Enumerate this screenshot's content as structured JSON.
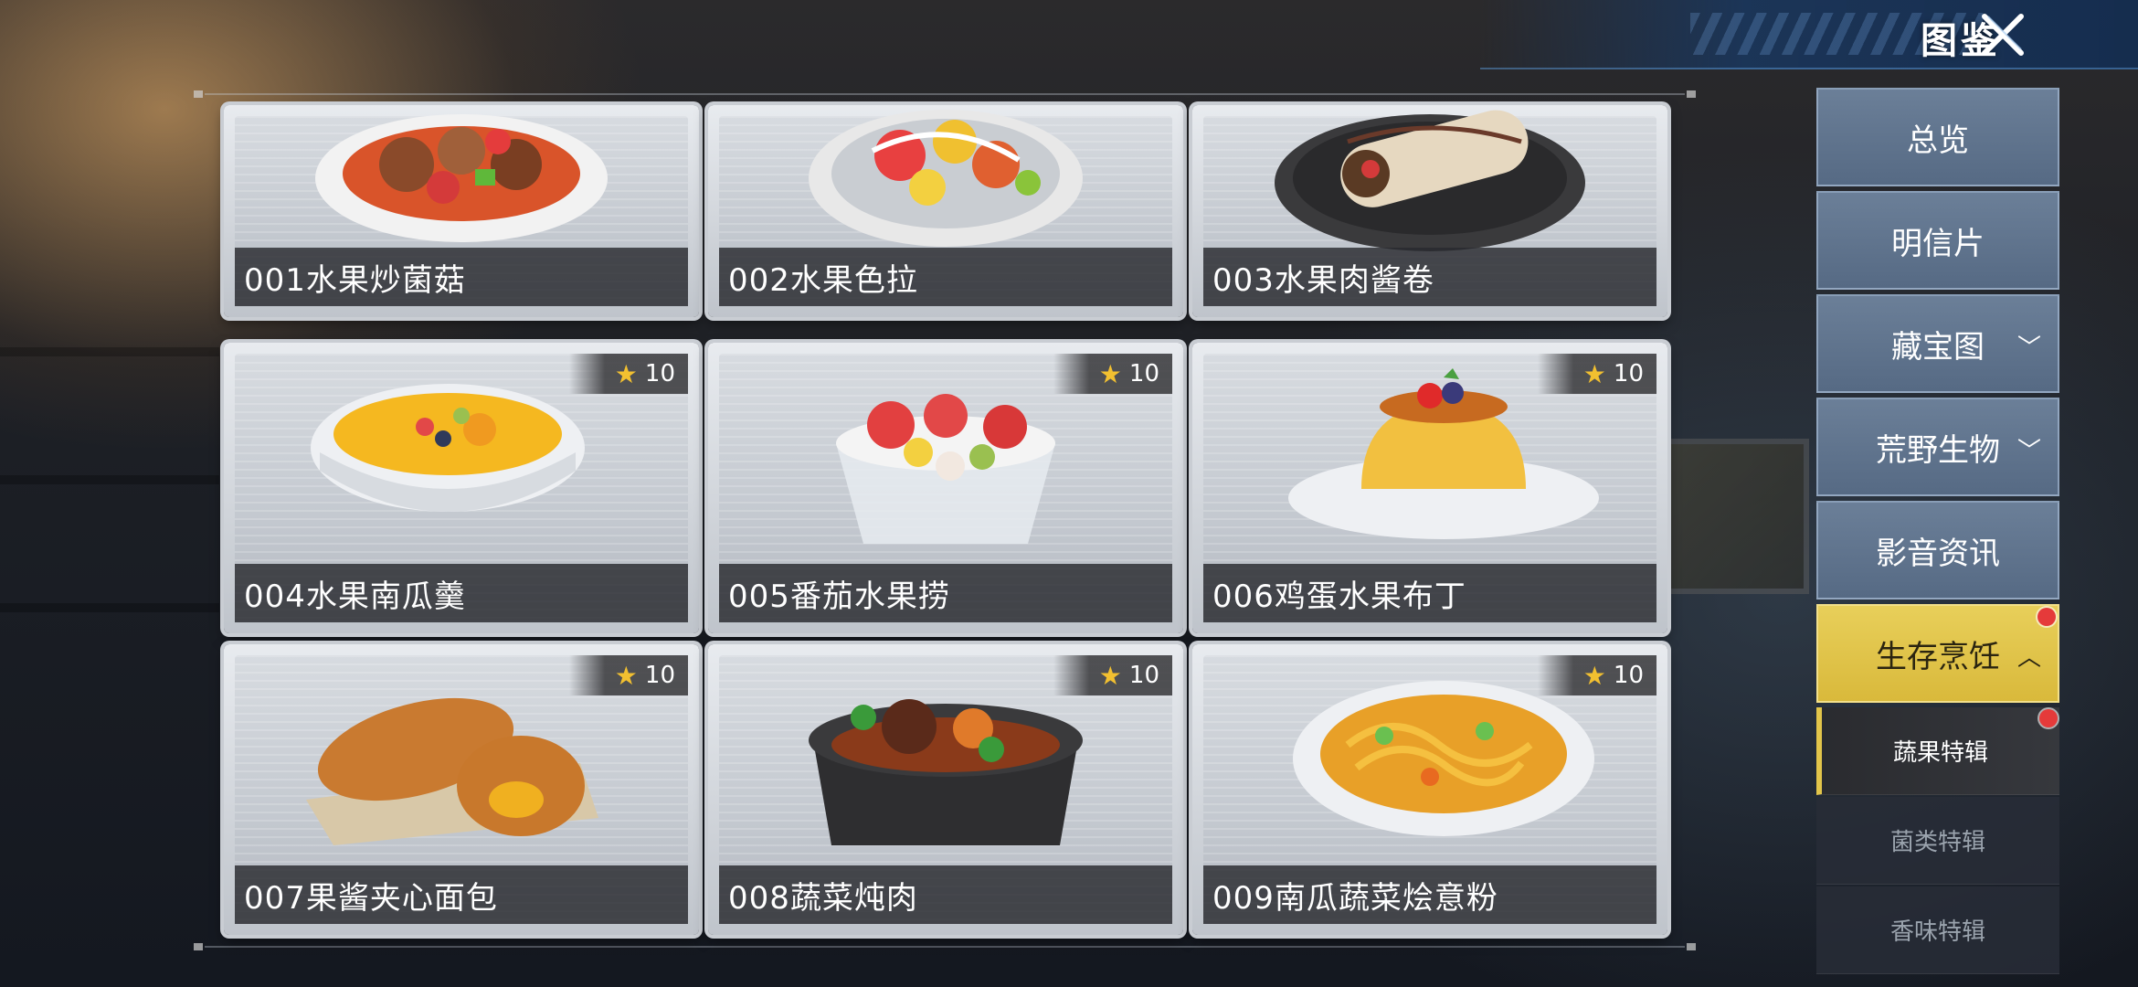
{
  "header": {
    "title": "图鉴"
  },
  "colors": {
    "accent": "#e2c54a",
    "nav_bg": "#5f738d",
    "badge_star": "#f2c030",
    "alert": "#e53a3a"
  },
  "recipes": [
    {
      "label": "001水果炒菌菇"
    },
    {
      "label": "002水果色拉"
    },
    {
      "label": "003水果肉酱卷"
    },
    {
      "label": "004水果南瓜羹",
      "stars": "10"
    },
    {
      "label": "005番茄水果捞",
      "stars": "10"
    },
    {
      "label": "006鸡蛋水果布丁",
      "stars": "10"
    },
    {
      "label": "007果酱夹心面包",
      "stars": "10"
    },
    {
      "label": "008蔬菜炖肉",
      "stars": "10"
    },
    {
      "label": "009南瓜蔬菜烩意粉",
      "stars": "10"
    }
  ],
  "sidebar": {
    "items": [
      {
        "label": "总览"
      },
      {
        "label": "明信片"
      },
      {
        "label": "藏宝图",
        "chevron": "down"
      },
      {
        "label": "荒野生物",
        "chevron": "down"
      },
      {
        "label": "影音资讯"
      },
      {
        "label": "生存烹饪",
        "chevron": "up",
        "active": true
      }
    ],
    "sub_items": [
      {
        "label": "蔬果特辑",
        "active": true
      },
      {
        "label": "菌类特辑"
      },
      {
        "label": "香味特辑"
      }
    ]
  },
  "icons": {
    "close": "close-x-icon",
    "star": "star-icon",
    "chevron_down": "chevron-down-icon",
    "chevron_up": "chevron-up-icon"
  }
}
